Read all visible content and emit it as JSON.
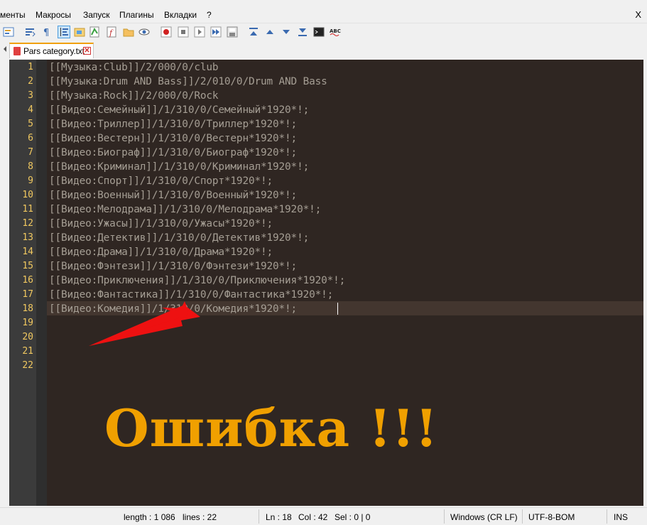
{
  "menu": {
    "items": [
      "менты",
      "Макросы",
      "Запуск",
      "Плагины",
      "Вкладки",
      "?"
    ],
    "close_label": "X"
  },
  "toolbar": {
    "icons": [
      "replace-icon",
      "wrap-icon",
      "pilcrow-icon",
      "indent-guide-icon",
      "folder-view-icon",
      "doc-map-icon",
      "function-list-icon",
      "folder-workspace-icon",
      "monitor-eye-icon",
      "record-macro-icon",
      "stop-record-icon",
      "play-macro-icon",
      "run-multiple-icon",
      "save-macro-icon",
      "collapse-icon",
      "move-up-icon",
      "move-down-icon",
      "expand-icon",
      "console-icon",
      "spellcheck-icon"
    ]
  },
  "tab": {
    "label": "Pars category.txt",
    "close_label": "✕"
  },
  "editor": {
    "line_numbers": [
      "1",
      "2",
      "3",
      "4",
      "5",
      "6",
      "7",
      "8",
      "9",
      "10",
      "11",
      "12",
      "13",
      "14",
      "15",
      "16",
      "17",
      "18",
      "19",
      "20",
      "21",
      "22"
    ],
    "lines": [
      "[[Музыка:Club]]/2/000/0/club",
      "[[Музыка:Drum AND Bass]]/2/010/0/Drum AND Bass",
      "[[Музыка:Rock]]/2/000/0/Rock",
      "[[Видео:Семейный]]/1/310/0/Семейный*1920*!;",
      "[[Видео:Триллер]]/1/310/0/Триллер*1920*!;",
      "[[Видео:Вестерн]]/1/310/0/Вестерн*1920*!;",
      "[[Видео:Биограф]]/1/310/0/Биограф*1920*!;",
      "[[Видео:Криминал]]/1/310/0/Криминал*1920*!;",
      "[[Видео:Спорт]]/1/310/0/Спорт*1920*!;",
      "[[Видео:Военный]]/1/310/0/Военный*1920*!;",
      "[[Видео:Мелодрама]]/1/310/0/Мелодрама*1920*!;",
      "[[Видео:Ужасы]]/1/310/0/Ужасы*1920*!;",
      "[[Видео:Детектив]]/1/310/0/Детектив*1920*!;",
      "[[Видео:Драма]]/1/310/0/Драма*1920*!;",
      "[[Видео:Фэнтези]]/1/310/0/Фэнтези*1920*!;",
      "[[Видео:Приключения]]/1/310/0/Приключения*1920*!;",
      "[[Видео:Фантастика]]/1/310/0/Фантастика*1920*!;",
      "[[Видео:Комедия]]/1/310/0/Комедия*1920*!;",
      "",
      "",
      "",
      ""
    ],
    "annotation": "Ошибка !!!",
    "annotation_color": "#f0a000",
    "arrow_color": "#ee1111"
  },
  "status": {
    "length": "length : 1 086",
    "lines": "lines : 22",
    "ln": "Ln : 18",
    "col": "Col : 42",
    "sel": "Sel : 0 | 0",
    "eol": "Windows (CR LF)",
    "encoding": "UTF-8-BOM",
    "mode": "INS"
  }
}
